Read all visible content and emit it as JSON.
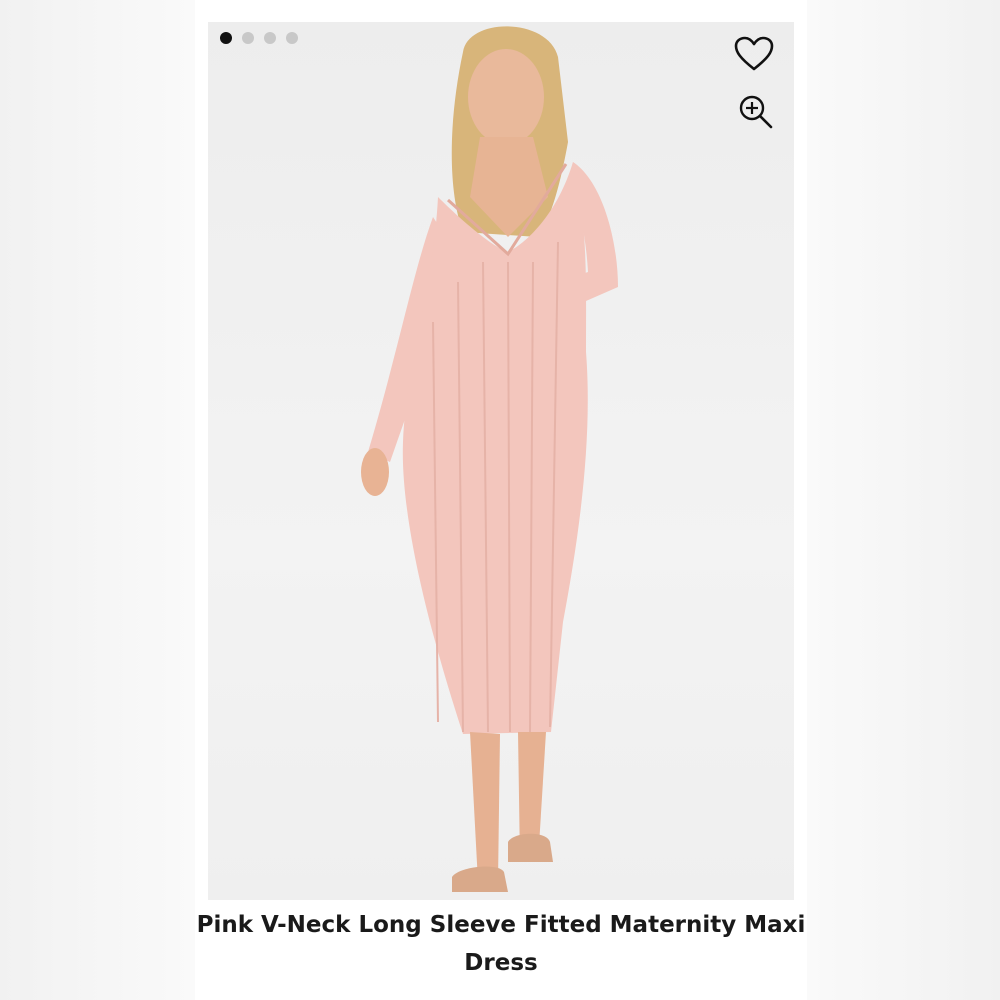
{
  "product": {
    "title": "Pink V-Neck Long Sleeve Fitted Maternity Maxi Dress"
  },
  "carousel": {
    "image_count": 4,
    "active_index": 0
  },
  "icons": {
    "favorite": "heart-icon",
    "zoom": "zoom-in-icon"
  },
  "colors": {
    "dress": "#f3c6bd",
    "active_dot": "#111111",
    "inactive_dot": "#c8c8c8"
  }
}
